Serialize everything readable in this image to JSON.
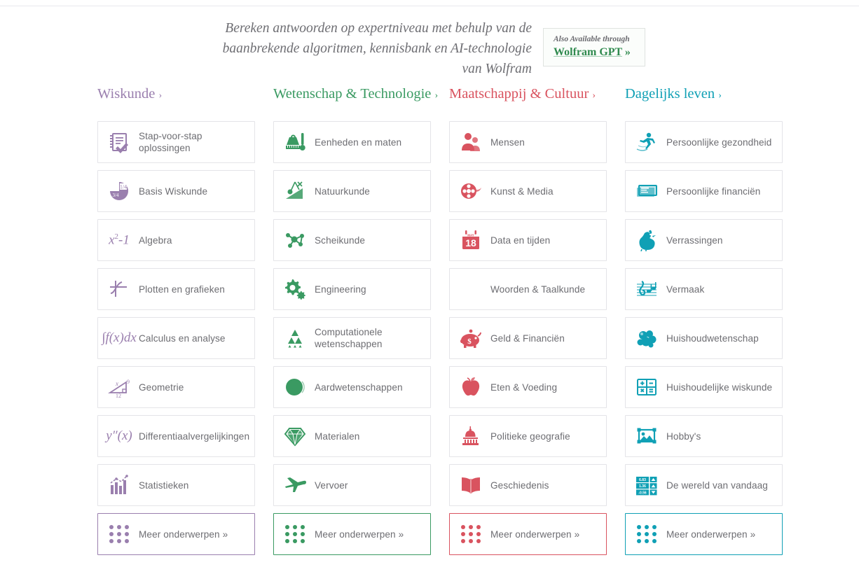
{
  "header": {
    "tagline": "Bereken antwoorden op expertniveau met behulp van de baanbrekende algoritmen, kennisbank en AI-technologie van Wolfram",
    "gpt_box": {
      "subtitle": "Also Available through",
      "title": "Wolfram GPT",
      "arrow": "»"
    }
  },
  "colors": {
    "math": "#9a7fae",
    "science": "#3a9a62",
    "society": "#d9535f",
    "life": "#10a0b5",
    "label_text": "#6d6d72",
    "card_border": "#e4e4e8",
    "page_bg": "#ffffff"
  },
  "columns": [
    {
      "title": "Wiskunde",
      "chevron": "›",
      "color": "#9a7fae",
      "items": [
        {
          "label": "Stap-voor-stap oplossingen",
          "icon": "notebook-check-icon"
        },
        {
          "label": "Basis Wiskunde",
          "icon": "pie-chart-fraction-icon"
        },
        {
          "label": "Algebra",
          "icon": "x-squared-minus-one-icon",
          "math": "x2-1"
        },
        {
          "label": "Plotten en grafieken",
          "icon": "plot-curve-icon"
        },
        {
          "label": "Calculus en analyse",
          "icon": "integral-icon",
          "math": "int-fx-dx"
        },
        {
          "label": "Geometrie",
          "icon": "right-triangle-icon"
        },
        {
          "label": "Differentiaalvergelijkingen",
          "icon": "second-derivative-icon",
          "math": "y''(x)"
        },
        {
          "label": "Statistieken",
          "icon": "bar-chart-trend-icon"
        },
        {
          "label": "Meer onderwerpen »",
          "icon": "grid-dots-icon",
          "more": true
        }
      ]
    },
    {
      "title": "Wetenschap & Technologie",
      "chevron": "›",
      "color": "#3a9a62",
      "items": [
        {
          "label": "Eenheden en maten",
          "icon": "weight-ruler-icon"
        },
        {
          "label": "Natuurkunde",
          "icon": "pendulum-incline-icon"
        },
        {
          "label": "Scheikunde",
          "icon": "molecule-icon"
        },
        {
          "label": "Engineering",
          "icon": "gears-icon"
        },
        {
          "label": "Computationele wetenschappen",
          "icon": "sierpinski-triangle-icon"
        },
        {
          "label": "Aardwetenschappen",
          "icon": "globe-layers-icon"
        },
        {
          "label": "Materialen",
          "icon": "diamond-icon"
        },
        {
          "label": "Vervoer",
          "icon": "airplane-icon"
        },
        {
          "label": "Meer onderwerpen »",
          "icon": "grid-dots-icon",
          "more": true
        }
      ]
    },
    {
      "title": "Maatschappij & Cultuur",
      "chevron": "›",
      "color": "#d9535f",
      "items": [
        {
          "label": "Mensen",
          "icon": "people-icon"
        },
        {
          "label": "Kunst & Media",
          "icon": "film-reel-icon"
        },
        {
          "label": "Data en tijden",
          "icon": "calendar-18-icon",
          "calendar_day": "18",
          "calendar_month": "MAY"
        },
        {
          "label": "Woorden & Taalkunde",
          "icon": "letters-icon"
        },
        {
          "label": "Geld & Financiën",
          "icon": "piggy-bank-icon"
        },
        {
          "label": "Eten & Voeding",
          "icon": "apple-icon"
        },
        {
          "label": "Politieke geografie",
          "icon": "capitol-building-icon"
        },
        {
          "label": "Geschiedenis",
          "icon": "open-book-icon"
        },
        {
          "label": "Meer onderwerpen »",
          "icon": "grid-dots-icon",
          "more": true
        }
      ]
    },
    {
      "title": "Dagelijks leven",
      "chevron": "›",
      "color": "#10a0b5",
      "items": [
        {
          "label": "Persoonlijke gezondheid",
          "icon": "runner-icon"
        },
        {
          "label": "Persoonlijke financiën",
          "icon": "banknotes-icon"
        },
        {
          "label": "Verrassingen",
          "icon": "chicken-icon"
        },
        {
          "label": "Vermaak",
          "icon": "music-staff-icon"
        },
        {
          "label": "Huishoudwetenschap",
          "icon": "bubbles-icon"
        },
        {
          "label": "Huishoudelijke wiskunde",
          "icon": "calculator-keys-icon"
        },
        {
          "label": "Hobby's",
          "icon": "photo-frame-icon"
        },
        {
          "label": "De wereld van vandaag",
          "icon": "stock-ticker-icon",
          "ticker": [
            "6.83",
            "1.36",
            "-0.56"
          ]
        },
        {
          "label": "Meer onderwerpen »",
          "icon": "grid-dots-icon",
          "more": true
        }
      ]
    }
  ]
}
